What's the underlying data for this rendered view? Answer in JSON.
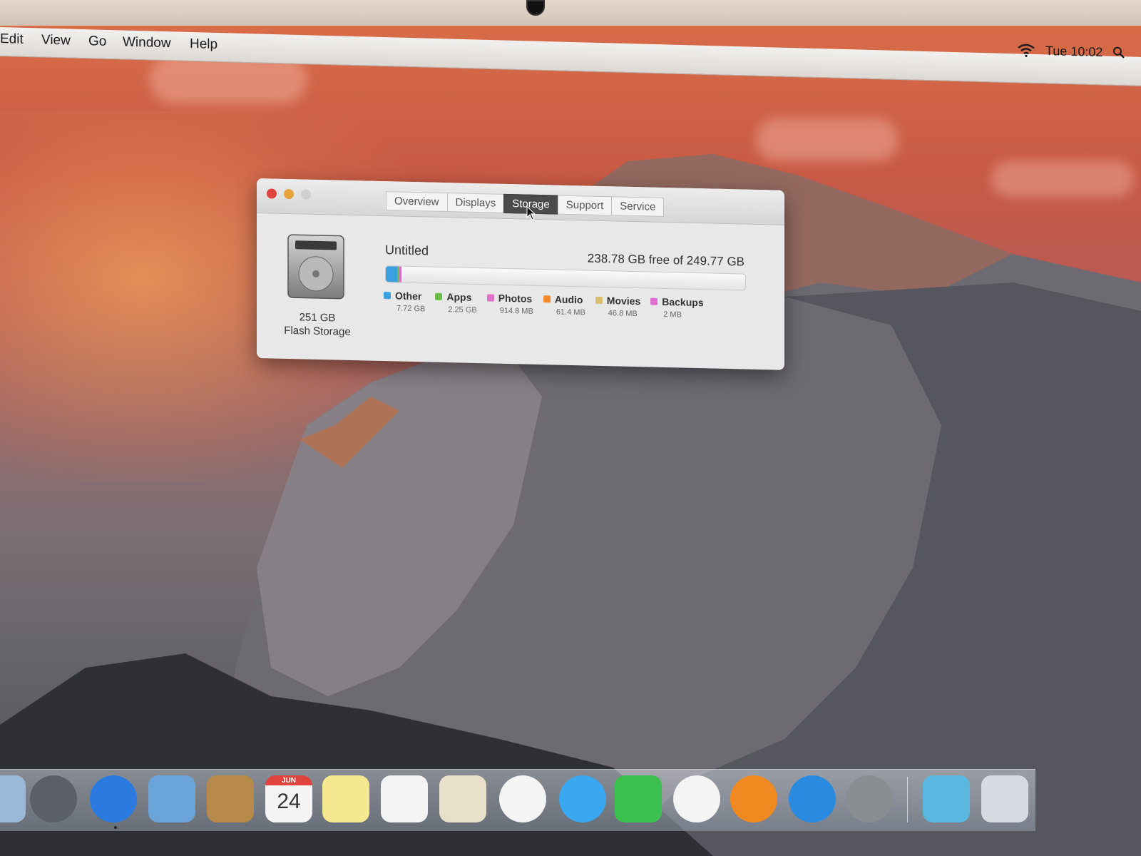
{
  "menubar": {
    "items": [
      "Edit",
      "View",
      "Go",
      "Window",
      "Help"
    ],
    "clock": "Tue 10:02"
  },
  "window": {
    "tabs": [
      "Overview",
      "Displays",
      "Storage",
      "Support",
      "Service"
    ],
    "active_tab": "Storage",
    "disk": {
      "capacity": "251 GB",
      "type": "Flash Storage"
    },
    "volume": {
      "name": "Untitled",
      "free_text": "238.78 GB free of 249.77 GB",
      "used_fraction": 0.044
    },
    "legend": [
      {
        "label": "Other",
        "size": "7.72 GB",
        "color": "#3aa0e0"
      },
      {
        "label": "Apps",
        "size": "2.25 GB",
        "color": "#6cc04a"
      },
      {
        "label": "Photos",
        "size": "914.8 MB",
        "color": "#e070c8"
      },
      {
        "label": "Audio",
        "size": "61.4 MB",
        "color": "#f08a2a"
      },
      {
        "label": "Movies",
        "size": "46.8 MB",
        "color": "#d8c070"
      },
      {
        "label": "Backups",
        "size": "2 MB",
        "color": "#e070d0"
      }
    ],
    "traffic_lights": {
      "close": "#e0443e",
      "minimize": "#e6a53a",
      "zoom": "#cfcfcf"
    }
  },
  "dock": {
    "apps": [
      {
        "name": "finder-icon",
        "color": "#9ab8d8"
      },
      {
        "name": "launchpad-icon",
        "color": "#5a5f68"
      },
      {
        "name": "safari-icon",
        "color": "#2a7ae0"
      },
      {
        "name": "mail-icon",
        "color": "#6aa4d8"
      },
      {
        "name": "contacts-icon",
        "color": "#b88a4a"
      },
      {
        "name": "calendar-icon",
        "color": "#f4f4f4",
        "month": "JUN",
        "day": "24"
      },
      {
        "name": "notes-icon",
        "color": "#f6e890"
      },
      {
        "name": "reminders-icon",
        "color": "#f4f4f4"
      },
      {
        "name": "preview-icon",
        "color": "#e8e0c8"
      },
      {
        "name": "photos-icon",
        "color": "#f4f4f4"
      },
      {
        "name": "messages-icon",
        "color": "#3aa8f0"
      },
      {
        "name": "facetime-icon",
        "color": "#3cc050"
      },
      {
        "name": "itunes-icon",
        "color": "#f4f4f4"
      },
      {
        "name": "ibooks-icon",
        "color": "#f08a20"
      },
      {
        "name": "app-store-icon",
        "color": "#2a8ae0"
      },
      {
        "name": "system-preferences-icon",
        "color": "#8a8d92"
      },
      {
        "name": "downloads-folder-icon",
        "color": "#5ab8e0"
      },
      {
        "name": "trash-icon",
        "color": "#d8dce2"
      }
    ]
  }
}
